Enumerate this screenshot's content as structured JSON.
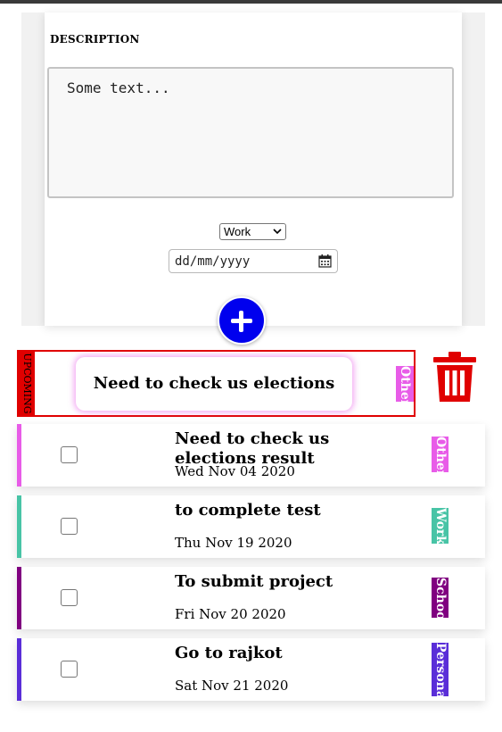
{
  "form": {
    "description_label": "DESCRIPTION",
    "description_value": "Some text...",
    "category_selected": "Work",
    "date_placeholder": "dd/mm/yyyy"
  },
  "dragging": {
    "status_label": "UPCOMING",
    "status_color": "#e00000",
    "title": "Need to check us elections result",
    "category": "Other",
    "category_color": "#e85ce8"
  },
  "todos": [
    {
      "title": "Need to check us elections result",
      "date": "Wed Nov 04 2020",
      "category": "Other",
      "color": "#e85ce8"
    },
    {
      "title": "to complete test",
      "date": "Thu Nov 19 2020",
      "category": "Work",
      "color": "#48c4a6"
    },
    {
      "title": "To submit project",
      "date": "Fri Nov 20 2020",
      "category": "School",
      "color": "#800080"
    },
    {
      "title": "Go to rajkot",
      "date": "Sat Nov 21 2020",
      "category": "Personal",
      "color": "#5a2ed8"
    }
  ],
  "colors": {
    "add_button": "#0000ee",
    "trash": "#e00000"
  },
  "icons": {
    "add": "plus-icon",
    "delete": "trash-icon",
    "calendar": "calendar-icon",
    "select": "chevron-down-icon"
  }
}
